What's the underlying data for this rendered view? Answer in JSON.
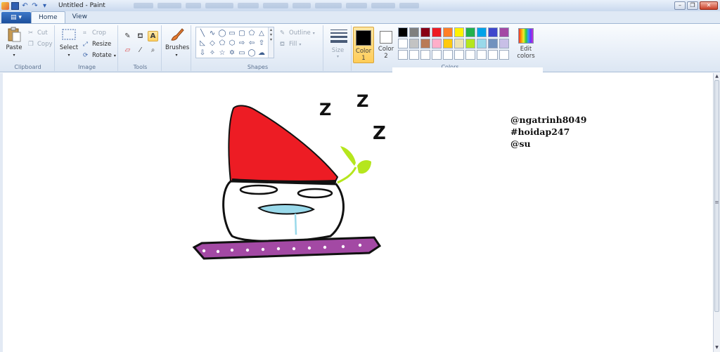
{
  "window": {
    "title": "Untitled - Paint"
  },
  "ribbon_tabs": {
    "home": "Home",
    "view": "View"
  },
  "clipboard": {
    "paste": "Paste",
    "cut": "Cut",
    "copy": "Copy",
    "label": "Clipboard"
  },
  "image": {
    "select": "Select",
    "crop": "Crop",
    "resize": "Resize",
    "rotate": "Rotate",
    "label": "Image"
  },
  "tools": {
    "label": "Tools",
    "text_tool": "A"
  },
  "brushes": {
    "label": "Brushes"
  },
  "shapes": {
    "label": "Shapes",
    "outline": "Outline",
    "fill": "Fill"
  },
  "size": {
    "label": "Size"
  },
  "colors": {
    "color1_label": "Color",
    "color1_num": "1",
    "color2_label": "Color",
    "color2_num": "2",
    "color1": "#000000",
    "color2": "#ffffff",
    "label": "Colors",
    "edit": "Edit",
    "edit2": "colors",
    "palette": [
      "#000000",
      "#7f7f7f",
      "#880015",
      "#ed1c24",
      "#ff7f27",
      "#fff200",
      "#22b14c",
      "#00a2e8",
      "#3f48cc",
      "#a349a4",
      "#ffffff",
      "#c3c3c3",
      "#b97a57",
      "#ffaec9",
      "#ffc90e",
      "#efe4b0",
      "#b5e61d",
      "#99d9ea",
      "#7092be",
      "#c8bfe7",
      "#ffffff",
      "#ffffff",
      "#ffffff",
      "#ffffff",
      "#ffffff",
      "#ffffff",
      "#ffffff",
      "#ffffff",
      "#ffffff",
      "#ffffff"
    ]
  },
  "canvas": {
    "sleep_marks": [
      "Z",
      "Z",
      "Z"
    ],
    "tags": [
      "@ngatrinh8049",
      "#hoidap247",
      "@su"
    ],
    "hat_color": "#ed1c24",
    "leaf_color": "#b5e61d",
    "board_color": "#a349a4",
    "mouth_color": "#99d9ea"
  }
}
